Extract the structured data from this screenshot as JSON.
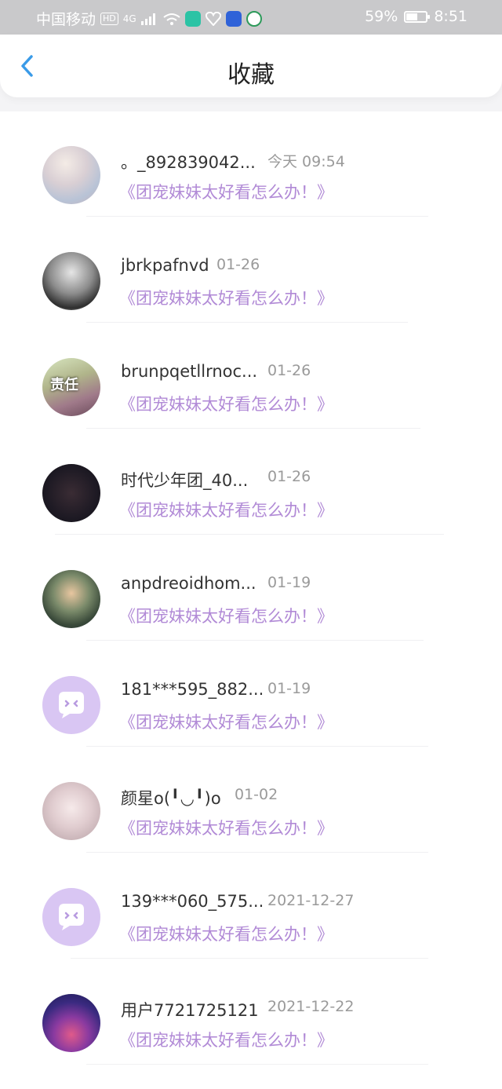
{
  "status_bar": {
    "carrier": "中国移动",
    "hd_badge": "HD",
    "network": "4G",
    "battery_text": "59%",
    "battery_level": 0.59,
    "time": "8:51"
  },
  "header": {
    "back_icon": "chevron-left-icon",
    "title": "收藏"
  },
  "items": [
    {
      "name": "。_892839042...",
      "time": "今天 09:54",
      "message": "《团宠妹妹太好看怎么办！》"
    },
    {
      "name": "jbrkpafnvd",
      "time": "01-26",
      "message": "《团宠妹妹太好看怎么办！》"
    },
    {
      "name": "brunpqetllrnoc...",
      "time": "01-26",
      "message": "《团宠妹妹太好看怎么办！》",
      "avatar_text": "责任"
    },
    {
      "name": "时代少年团_40...",
      "time": "01-26",
      "message": "《团宠妹妹太好看怎么办！》"
    },
    {
      "name": "anpdreoidhom...",
      "time": "01-19",
      "message": "《团宠妹妹太好看怎么办！》"
    },
    {
      "name": "181***595_882...",
      "time": "01-19",
      "message": "《团宠妹妹太好看怎么办！》"
    },
    {
      "name": "颜星o(╹◡╹)o",
      "time": "01-02",
      "message": "《团宠妹妹太好看怎么办！》"
    },
    {
      "name": "139***060_575...",
      "time": "2021-12-27",
      "message": "《团宠妹妹太好看怎么办！》"
    },
    {
      "name": "用户7721725121",
      "time": "2021-12-22",
      "message": "《团宠妹妹太好看怎么办！》"
    }
  ],
  "colors": {
    "accent": "#3a9be8",
    "message": "#b18ad6",
    "default_avatar": "#d9c6f3"
  }
}
